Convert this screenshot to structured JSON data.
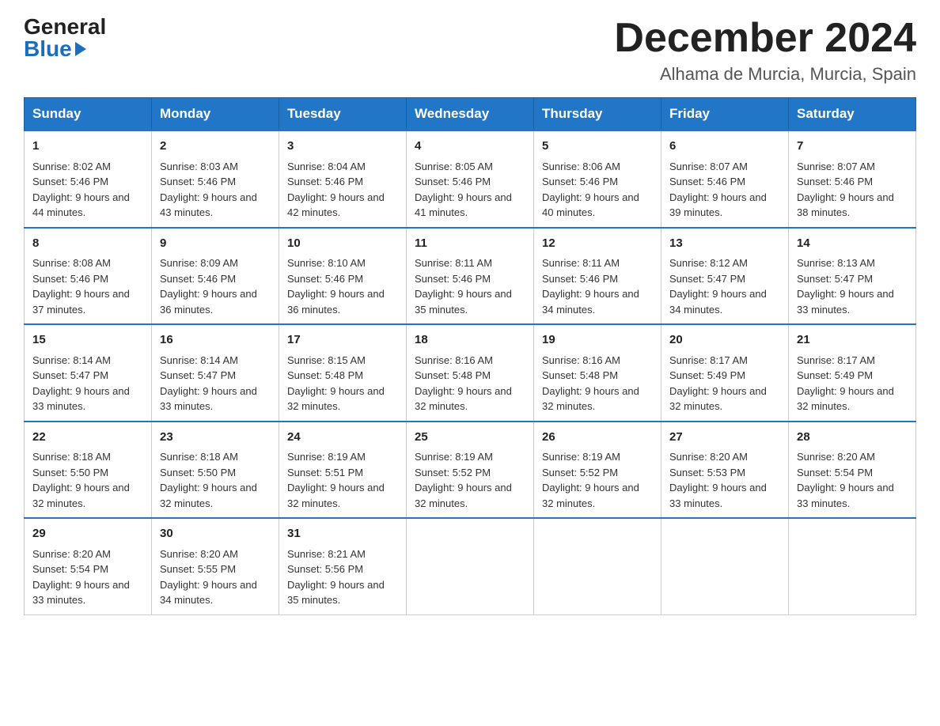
{
  "logo": {
    "general": "General",
    "blue": "Blue"
  },
  "title": "December 2024",
  "location": "Alhama de Murcia, Murcia, Spain",
  "days_of_week": [
    "Sunday",
    "Monday",
    "Tuesday",
    "Wednesday",
    "Thursday",
    "Friday",
    "Saturday"
  ],
  "weeks": [
    [
      {
        "day": "1",
        "sunrise": "8:02 AM",
        "sunset": "5:46 PM",
        "daylight": "9 hours and 44 minutes."
      },
      {
        "day": "2",
        "sunrise": "8:03 AM",
        "sunset": "5:46 PM",
        "daylight": "9 hours and 43 minutes."
      },
      {
        "day": "3",
        "sunrise": "8:04 AM",
        "sunset": "5:46 PM",
        "daylight": "9 hours and 42 minutes."
      },
      {
        "day": "4",
        "sunrise": "8:05 AM",
        "sunset": "5:46 PM",
        "daylight": "9 hours and 41 minutes."
      },
      {
        "day": "5",
        "sunrise": "8:06 AM",
        "sunset": "5:46 PM",
        "daylight": "9 hours and 40 minutes."
      },
      {
        "day": "6",
        "sunrise": "8:07 AM",
        "sunset": "5:46 PM",
        "daylight": "9 hours and 39 minutes."
      },
      {
        "day": "7",
        "sunrise": "8:07 AM",
        "sunset": "5:46 PM",
        "daylight": "9 hours and 38 minutes."
      }
    ],
    [
      {
        "day": "8",
        "sunrise": "8:08 AM",
        "sunset": "5:46 PM",
        "daylight": "9 hours and 37 minutes."
      },
      {
        "day": "9",
        "sunrise": "8:09 AM",
        "sunset": "5:46 PM",
        "daylight": "9 hours and 36 minutes."
      },
      {
        "day": "10",
        "sunrise": "8:10 AM",
        "sunset": "5:46 PM",
        "daylight": "9 hours and 36 minutes."
      },
      {
        "day": "11",
        "sunrise": "8:11 AM",
        "sunset": "5:46 PM",
        "daylight": "9 hours and 35 minutes."
      },
      {
        "day": "12",
        "sunrise": "8:11 AM",
        "sunset": "5:46 PM",
        "daylight": "9 hours and 34 minutes."
      },
      {
        "day": "13",
        "sunrise": "8:12 AM",
        "sunset": "5:47 PM",
        "daylight": "9 hours and 34 minutes."
      },
      {
        "day": "14",
        "sunrise": "8:13 AM",
        "sunset": "5:47 PM",
        "daylight": "9 hours and 33 minutes."
      }
    ],
    [
      {
        "day": "15",
        "sunrise": "8:14 AM",
        "sunset": "5:47 PM",
        "daylight": "9 hours and 33 minutes."
      },
      {
        "day": "16",
        "sunrise": "8:14 AM",
        "sunset": "5:47 PM",
        "daylight": "9 hours and 33 minutes."
      },
      {
        "day": "17",
        "sunrise": "8:15 AM",
        "sunset": "5:48 PM",
        "daylight": "9 hours and 32 minutes."
      },
      {
        "day": "18",
        "sunrise": "8:16 AM",
        "sunset": "5:48 PM",
        "daylight": "9 hours and 32 minutes."
      },
      {
        "day": "19",
        "sunrise": "8:16 AM",
        "sunset": "5:48 PM",
        "daylight": "9 hours and 32 minutes."
      },
      {
        "day": "20",
        "sunrise": "8:17 AM",
        "sunset": "5:49 PM",
        "daylight": "9 hours and 32 minutes."
      },
      {
        "day": "21",
        "sunrise": "8:17 AM",
        "sunset": "5:49 PM",
        "daylight": "9 hours and 32 minutes."
      }
    ],
    [
      {
        "day": "22",
        "sunrise": "8:18 AM",
        "sunset": "5:50 PM",
        "daylight": "9 hours and 32 minutes."
      },
      {
        "day": "23",
        "sunrise": "8:18 AM",
        "sunset": "5:50 PM",
        "daylight": "9 hours and 32 minutes."
      },
      {
        "day": "24",
        "sunrise": "8:19 AM",
        "sunset": "5:51 PM",
        "daylight": "9 hours and 32 minutes."
      },
      {
        "day": "25",
        "sunrise": "8:19 AM",
        "sunset": "5:52 PM",
        "daylight": "9 hours and 32 minutes."
      },
      {
        "day": "26",
        "sunrise": "8:19 AM",
        "sunset": "5:52 PM",
        "daylight": "9 hours and 32 minutes."
      },
      {
        "day": "27",
        "sunrise": "8:20 AM",
        "sunset": "5:53 PM",
        "daylight": "9 hours and 33 minutes."
      },
      {
        "day": "28",
        "sunrise": "8:20 AM",
        "sunset": "5:54 PM",
        "daylight": "9 hours and 33 minutes."
      }
    ],
    [
      {
        "day": "29",
        "sunrise": "8:20 AM",
        "sunset": "5:54 PM",
        "daylight": "9 hours and 33 minutes."
      },
      {
        "day": "30",
        "sunrise": "8:20 AM",
        "sunset": "5:55 PM",
        "daylight": "9 hours and 34 minutes."
      },
      {
        "day": "31",
        "sunrise": "8:21 AM",
        "sunset": "5:56 PM",
        "daylight": "9 hours and 35 minutes."
      },
      null,
      null,
      null,
      null
    ]
  ]
}
